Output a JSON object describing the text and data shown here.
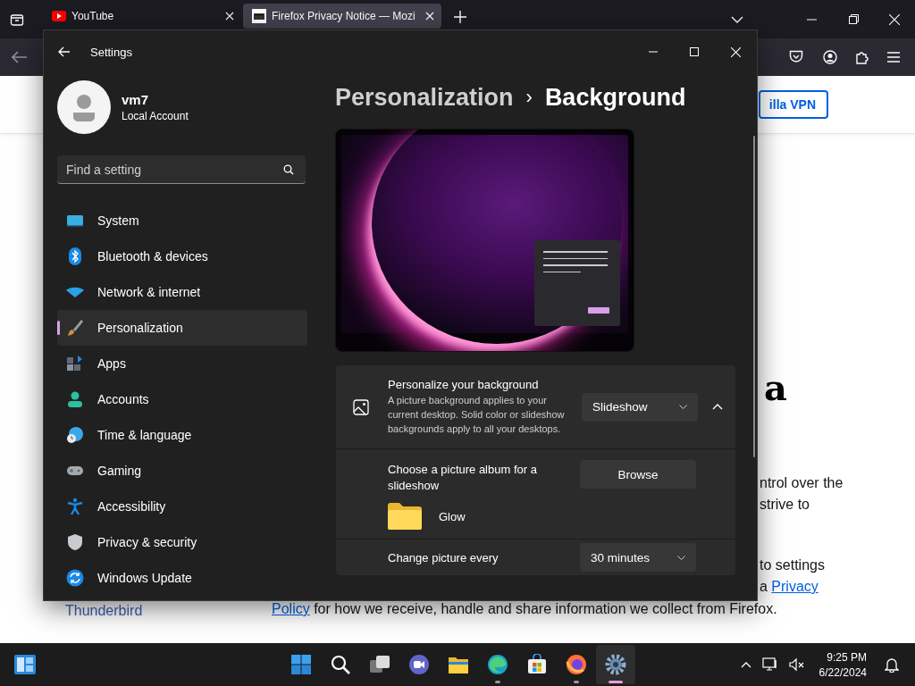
{
  "browser": {
    "tabs": [
      {
        "title": "YouTube",
        "kind": "youtube",
        "selected": false
      },
      {
        "title": "Firefox Privacy Notice — Mozi",
        "kind": "mozilla",
        "selected": true
      }
    ],
    "page": {
      "vpn_button": "illa VPN",
      "heading_fragment": "a",
      "lines": [
        {
          "text": "ntrol over the"
        },
        {
          "text": "strive to"
        },
        {
          "text": "to settings"
        },
        {
          "text": "a ",
          "link": "Privacy"
        }
      ],
      "last_line": {
        "link": "Policy",
        "text": " for how we receive, handle and share information we collect from Firefox."
      },
      "side_link": "Thunderbird"
    }
  },
  "settings": {
    "title": "Settings",
    "account": {
      "name": "vm7",
      "type": "Local Account"
    },
    "search": {
      "placeholder": "Find a setting"
    },
    "nav": [
      {
        "label": "System",
        "kind": "system",
        "selected": false
      },
      {
        "label": "Bluetooth & devices",
        "kind": "bluetooth",
        "selected": false
      },
      {
        "label": "Network & internet",
        "kind": "network",
        "selected": false
      },
      {
        "label": "Personalization",
        "kind": "brush",
        "selected": true
      },
      {
        "label": "Apps",
        "kind": "apps",
        "selected": false
      },
      {
        "label": "Accounts",
        "kind": "person",
        "selected": false
      },
      {
        "label": "Time & language",
        "kind": "time",
        "selected": false
      },
      {
        "label": "Gaming",
        "kind": "gamepad",
        "selected": false
      },
      {
        "label": "Accessibility",
        "kind": "accessibility",
        "selected": false
      },
      {
        "label": "Privacy & security",
        "kind": "shield",
        "selected": false
      },
      {
        "label": "Windows Update",
        "kind": "update",
        "selected": false
      }
    ],
    "breadcrumb": {
      "parent": "Personalization",
      "separator": "›",
      "current": "Background"
    },
    "background": {
      "title": "Personalize your background",
      "description": "A picture background applies to your current desktop. Solid color or slideshow backgrounds apply to all your desktops.",
      "mode": "Slideshow",
      "expanded": true,
      "album_label": "Choose a picture album for a slideshow",
      "browse": "Browse",
      "folder": "Glow",
      "interval_label": "Change picture every",
      "interval": "30 minutes"
    }
  },
  "taskbar": {
    "apps": [
      {
        "kind": "start",
        "running": false,
        "selected": false
      },
      {
        "kind": "search",
        "running": false,
        "selected": false
      },
      {
        "kind": "taskview",
        "running": false,
        "selected": false
      },
      {
        "kind": "chat",
        "running": false,
        "selected": false
      },
      {
        "kind": "explorer",
        "running": false,
        "selected": false
      },
      {
        "kind": "edge",
        "running": true,
        "selected": false
      },
      {
        "kind": "store",
        "running": false,
        "selected": false
      },
      {
        "kind": "firefox",
        "running": true,
        "selected": false
      },
      {
        "kind": "settings",
        "running": true,
        "selected": true
      }
    ],
    "time": "9:25 PM",
    "date": "6/22/2024"
  }
}
